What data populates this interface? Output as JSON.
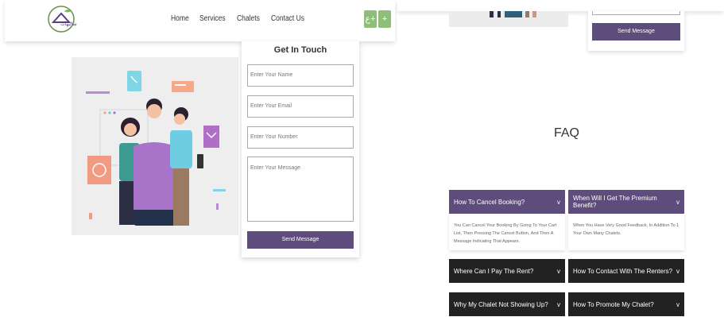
{
  "nav": {
    "logo_text": "شاليهات",
    "links": [
      "Home",
      "Services",
      "Chalets",
      "Contact Us"
    ],
    "lang_button": "ع+",
    "plus_button": "+"
  },
  "contact": {
    "title": "Get In Touch",
    "name_placeholder": "Enter Your Name",
    "email_placeholder": "Enter Your Email",
    "number_placeholder": "Enter Your Number",
    "message_placeholder": "Enter Your Message",
    "send_label": "Send Message"
  },
  "right": {
    "send_label": "Send Message"
  },
  "faq": {
    "title": "FAQ",
    "items": [
      {
        "question": "How To Cancel Booking?",
        "answer": "You Can Cancel Your Booking By Going To Your Cart List, Then Pressing The Cancel Button, And Then A Message Indicating That Appears.",
        "open": true
      },
      {
        "question": "When Will I Get The Premium Benefit?",
        "answer": "When You Have Very Good Feedback, In Addition To 1 Your Own Many Chalets.",
        "open": true
      },
      {
        "question": "Where Can I Pay The Rent?",
        "answer": "",
        "open": false
      },
      {
        "question": "How To Contact With The Renters?",
        "answer": "",
        "open": false
      },
      {
        "question": "Why My Chalet Not Showing Up?",
        "answer": "",
        "open": false
      },
      {
        "question": "How To Promote My Chalet?",
        "answer": "",
        "open": false
      }
    ]
  },
  "colors": {
    "accent_purple": "#5e4d7c",
    "dark_header": "#222222",
    "nav_green": "#8fbe7b"
  }
}
